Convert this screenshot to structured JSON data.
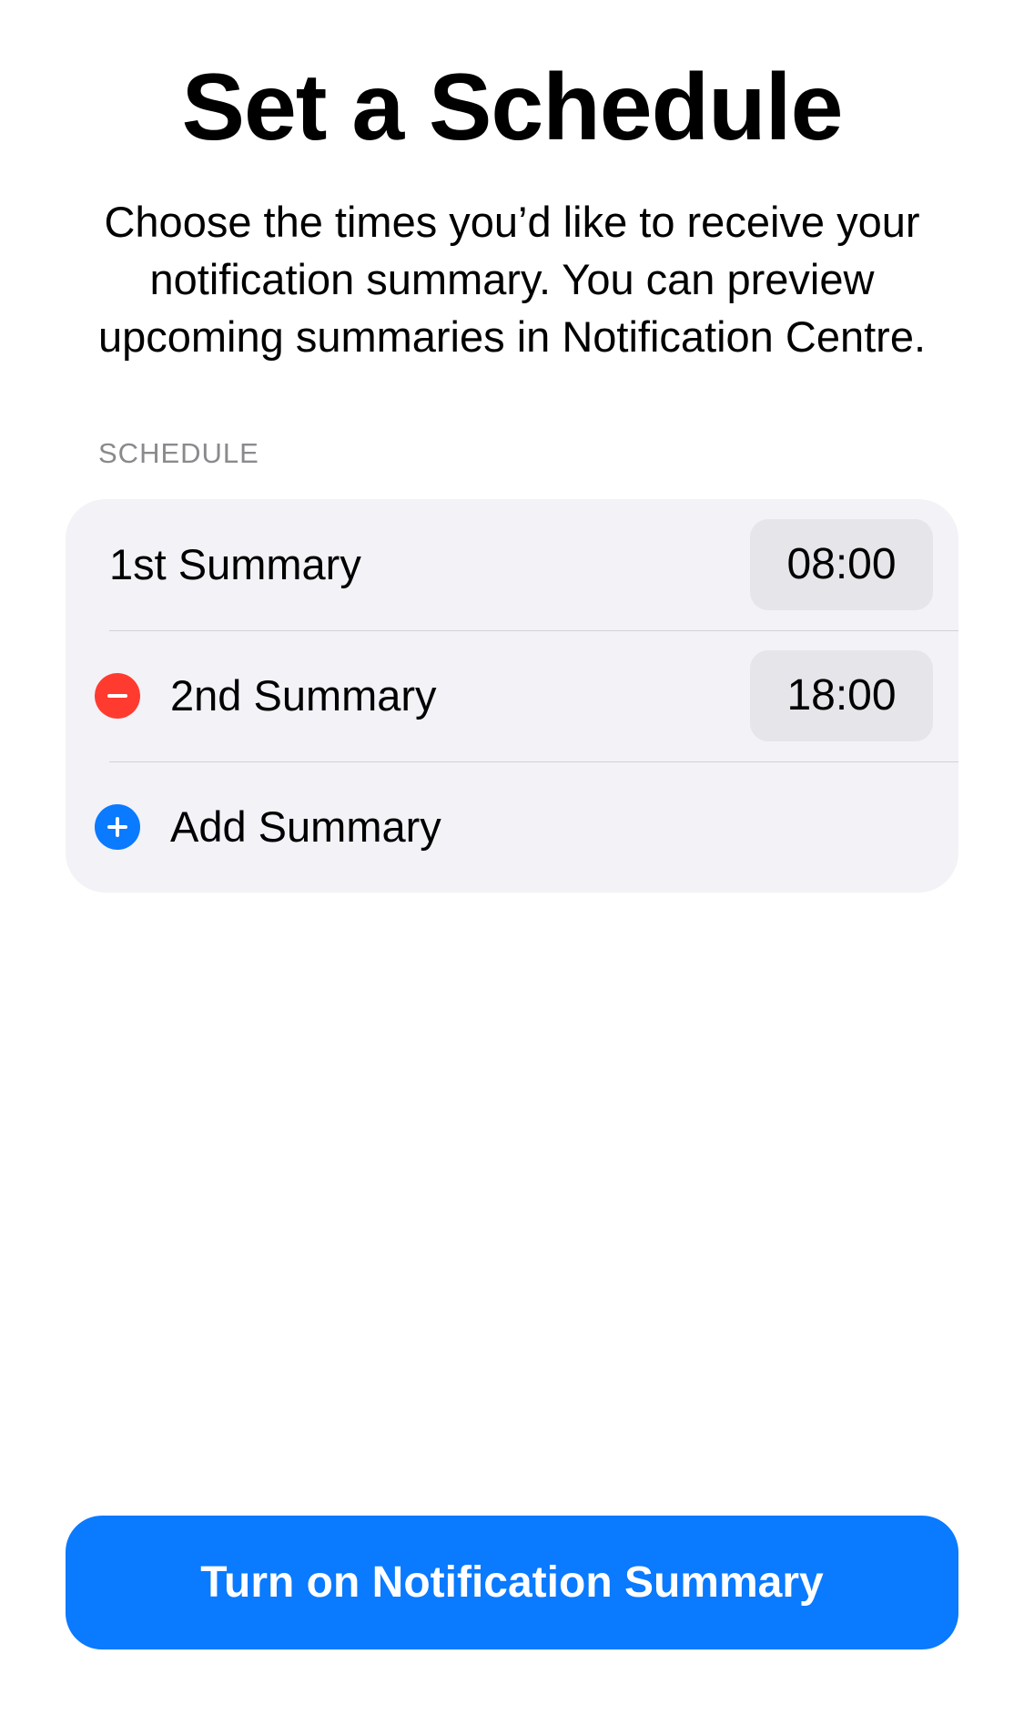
{
  "page": {
    "title": "Set a Schedule",
    "description": "Choose the times you’d like to receive your notification summary. You can preview upcoming summaries in Notification Centre."
  },
  "schedule": {
    "section_header": "SCHEDULE",
    "rows": [
      {
        "label": "1st Summary",
        "time": "08:00"
      },
      {
        "label": "2nd Summary",
        "time": "18:00",
        "icon": "remove-circle-icon"
      },
      {
        "label": "Add Summary",
        "icon": "add-circle-icon"
      }
    ]
  },
  "footer": {
    "primary_button_label": "Turn on Notification Summary"
  },
  "colors": {
    "accent": "#0a7aff",
    "destructive": "#ff3b30",
    "card_background": "#f2f2f7",
    "pill_background": "#e5e5ea",
    "secondary_text": "#8a8a8e"
  }
}
